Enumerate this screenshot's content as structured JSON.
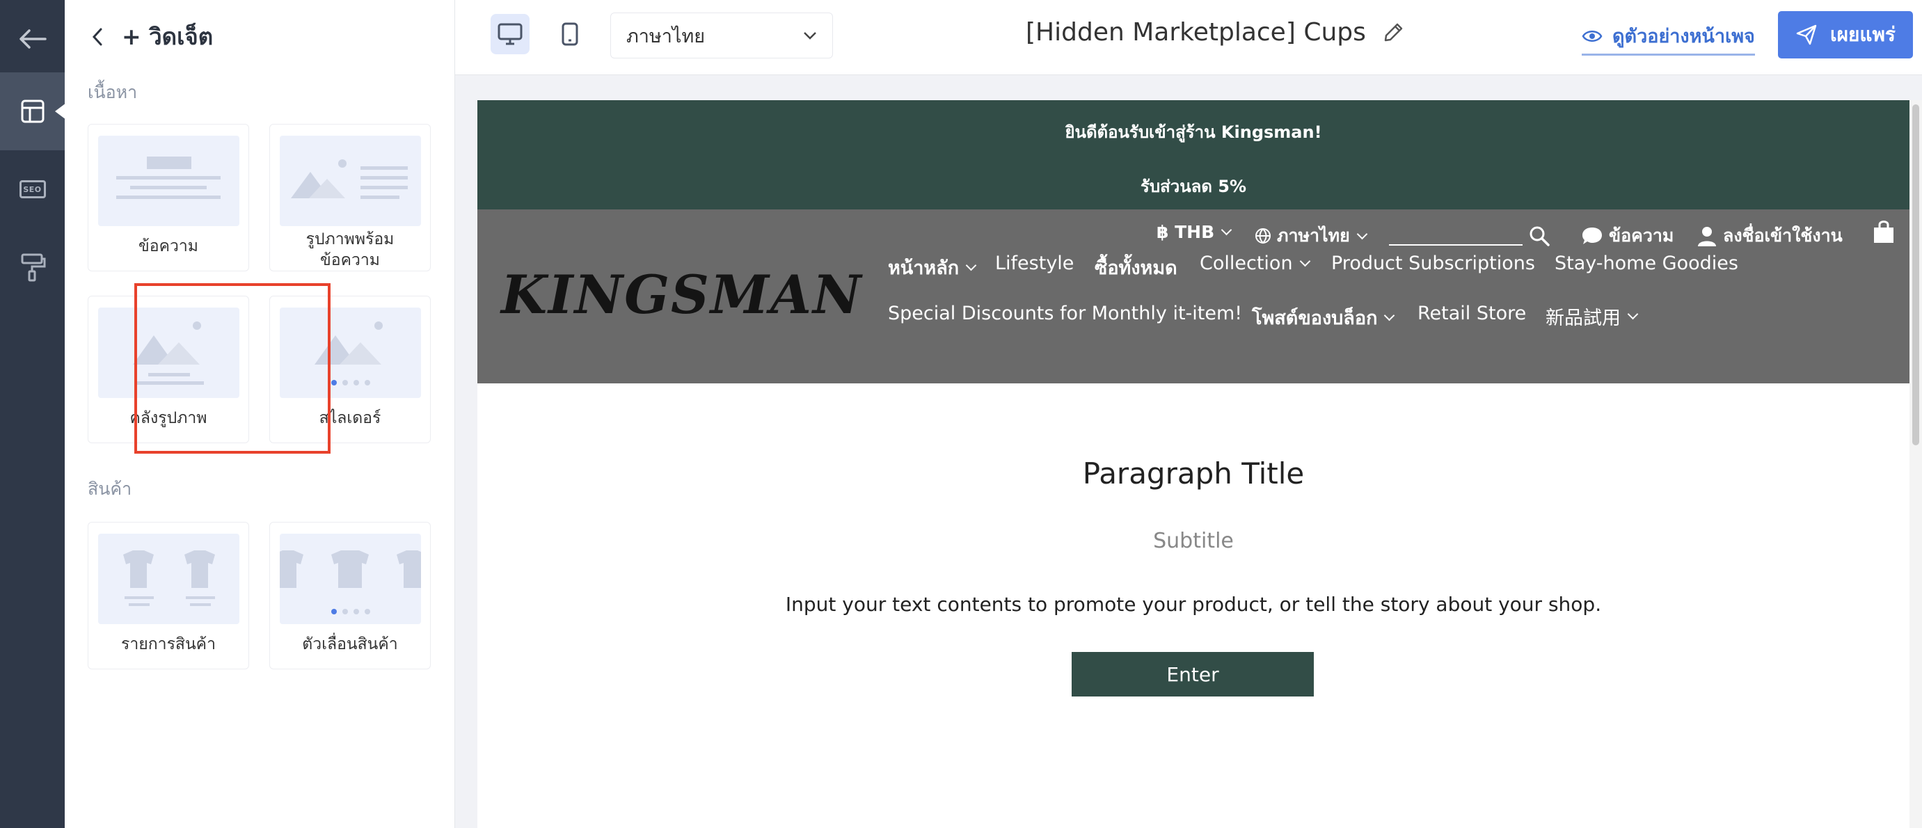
{
  "rail": {
    "items": [
      {
        "name": "back",
        "icon": "arrow-left-icon"
      },
      {
        "name": "layout",
        "icon": "layout-icon",
        "active": true
      },
      {
        "name": "seo",
        "icon": "seo-icon",
        "text": "SEO"
      },
      {
        "name": "design",
        "icon": "paint-roller-icon"
      }
    ]
  },
  "panel": {
    "back_icon": "chevron-left-icon",
    "title": "+ วิดเจ็ต",
    "content_section": "เนื้อหา",
    "products_section": "สินค้า",
    "widgets": {
      "text": "ข้อความ",
      "image_with_text_l1": "รูปภาพพร้อม",
      "image_with_text_l2": "ข้อความ",
      "gallery": "คลังรูปภาพ",
      "slider": "สไลเดอร์",
      "product_list": "รายการสินค้า",
      "product_slider": "ตัวเลื่อนสินค้า"
    },
    "highlight_color": "#e8422c"
  },
  "toolbar": {
    "desktop_icon": "desktop-icon",
    "mobile_icon": "mobile-icon",
    "language_value": "ภาษาไทย",
    "page_title": "[Hidden Marketplace] Cups",
    "edit_icon": "pencil-icon",
    "preview_label": "ดูตัวอย่างหน้าเพจ",
    "publish_label": "เผยแพร่",
    "accent": "#4e7ce5"
  },
  "canvas": {
    "announcement_1": "ยินดีต้อนรับเข้าสู่ร้าน Kingsman!",
    "announcement_2": "รับส่วนลด 5%",
    "announcement_bg": "#324d47",
    "header_bg": "#6a6a6a",
    "logo": "KINGSMAN",
    "currency": "฿ THB",
    "language": "ภาษาไทย",
    "message": "ข้อความ",
    "login": "ลงชื่อเข้าใช้งาน",
    "nav": {
      "home": "หน้าหลัก",
      "lifestyle": "Lifestyle",
      "all": "ซื้อทั้งหมด",
      "collection": "Collection",
      "subscriptions": "Product Subscriptions",
      "stay_home": "Stay-home Goodies",
      "special": "Special Discounts for Monthly it-item!",
      "blog": "โพสต์ของบล็อก",
      "retail": "Retail Store",
      "new": "新品試用"
    },
    "paragraph_title": "Paragraph Title",
    "subtitle": "Subtitle",
    "body": "Input your text contents to promote your product, or tell the story about your shop.",
    "button": "Enter"
  }
}
